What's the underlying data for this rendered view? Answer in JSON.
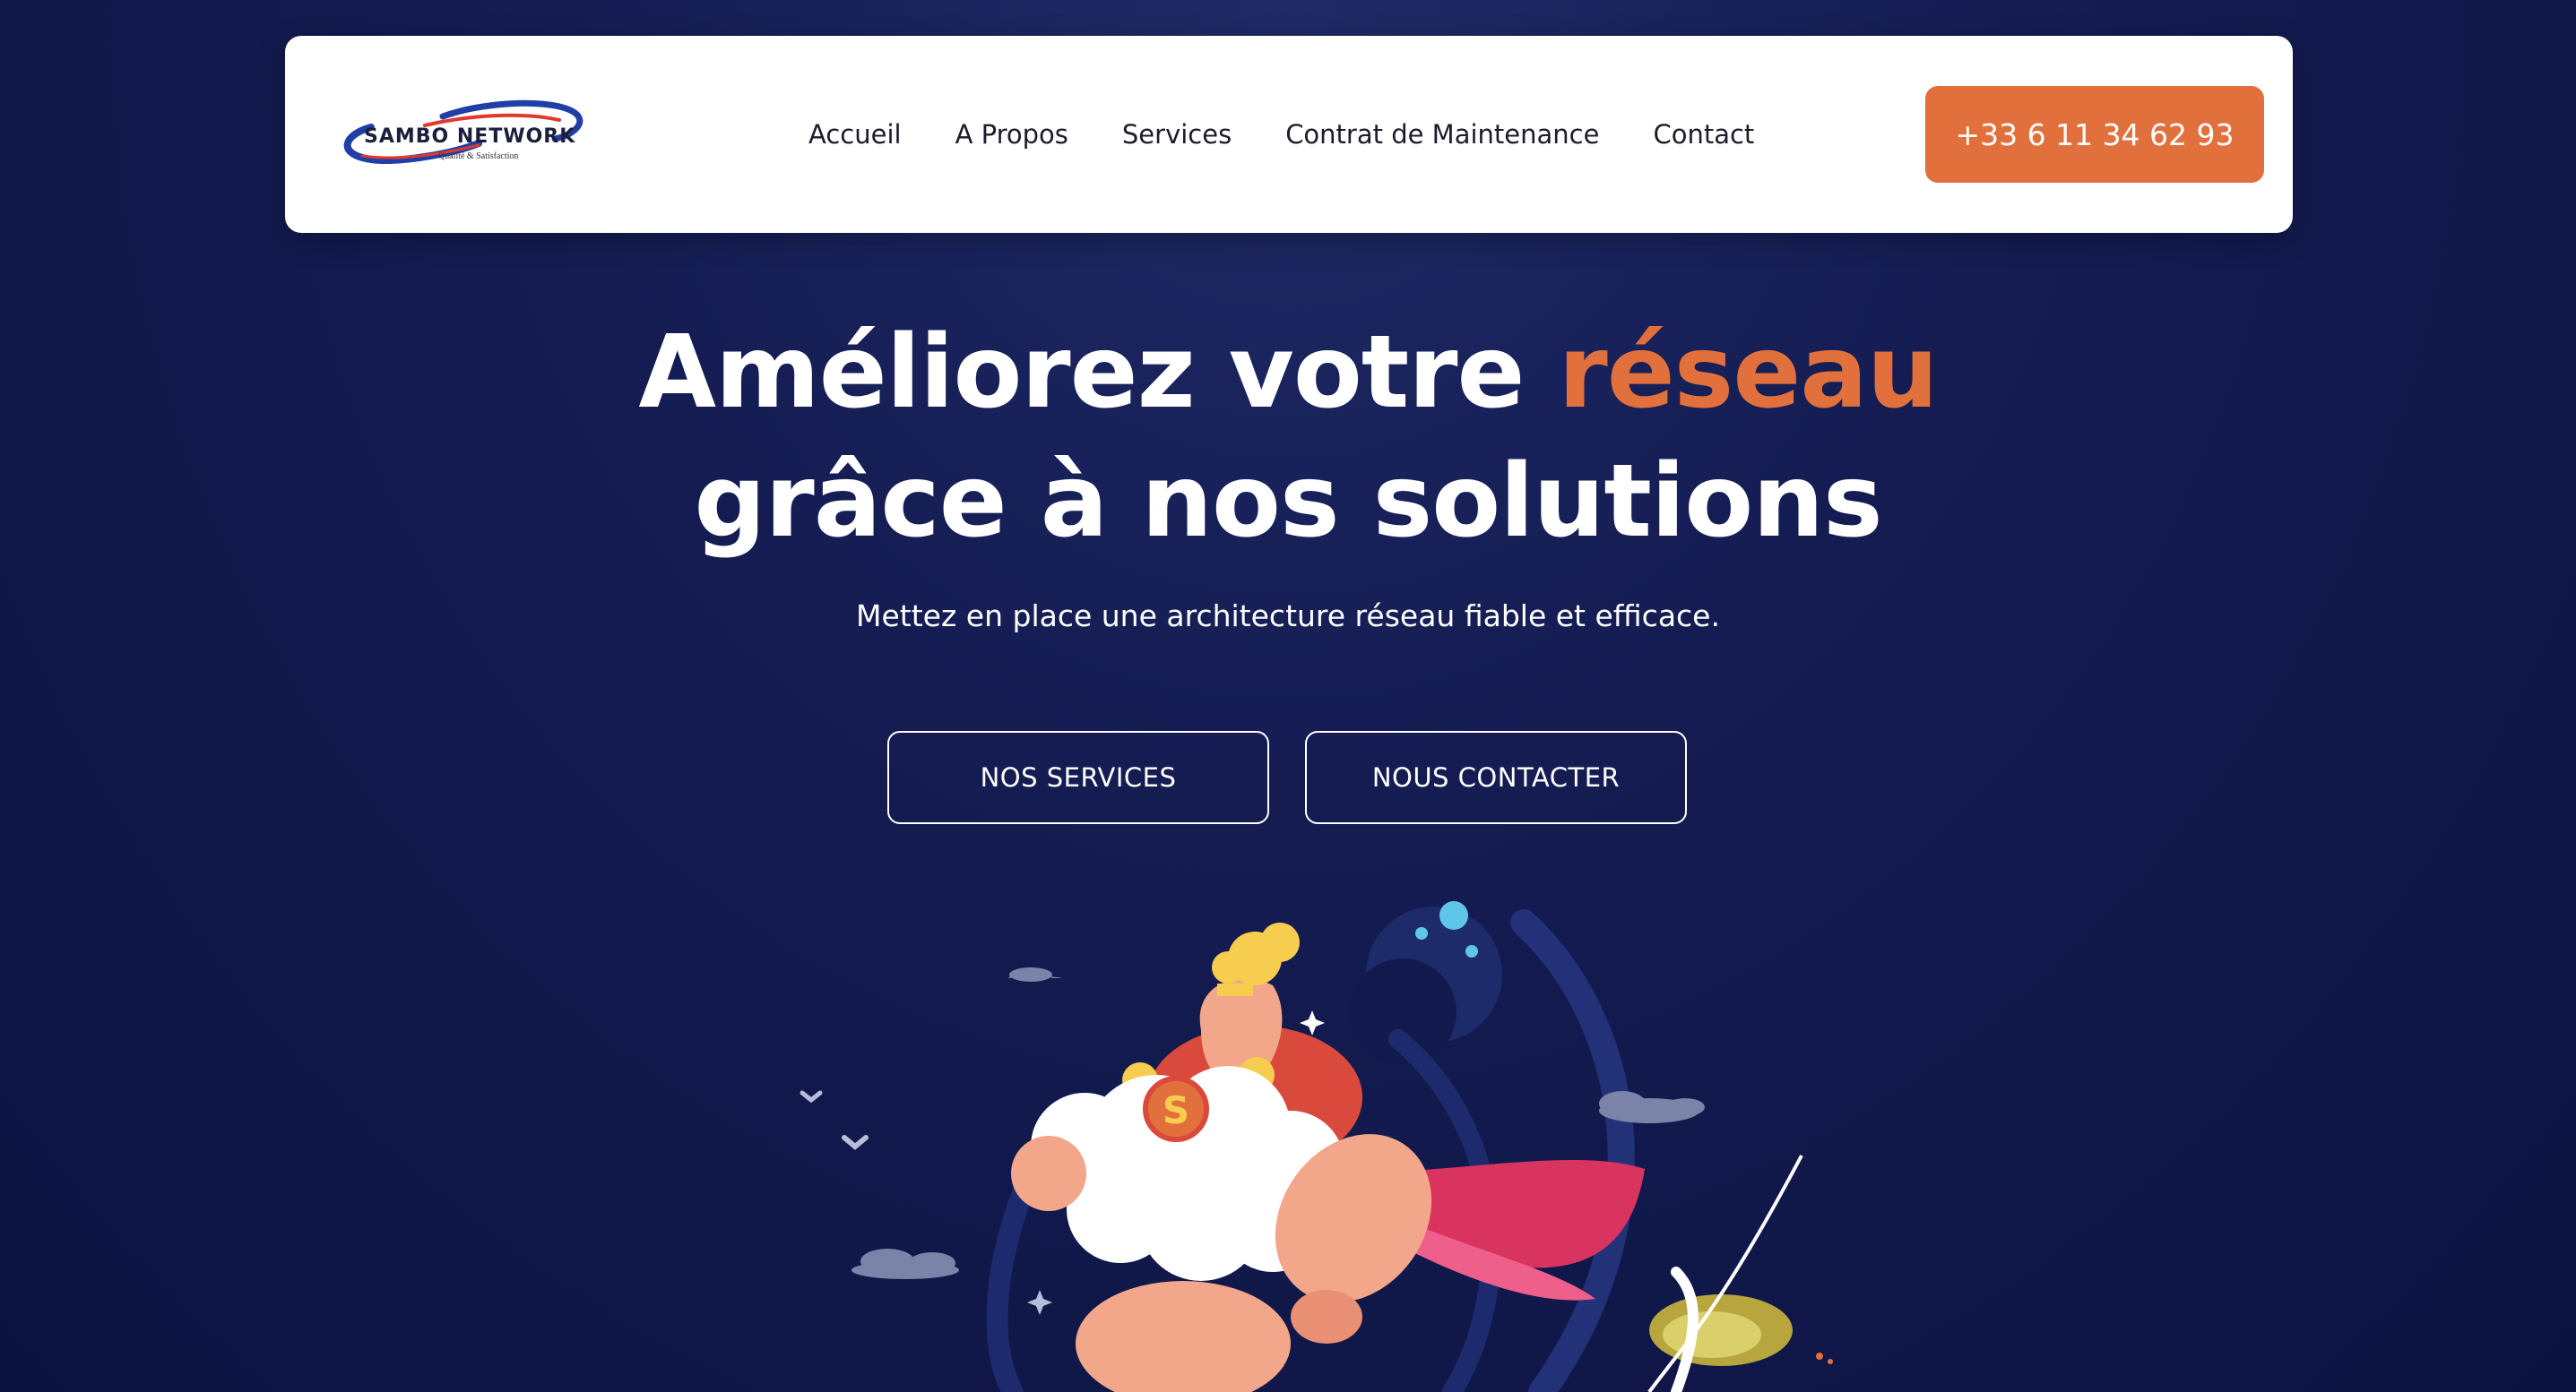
{
  "header": {
    "logo": {
      "name": "SAMBO NETWORK",
      "tagline": "Qualité & Satisfaction"
    },
    "nav": [
      {
        "label": "Accueil"
      },
      {
        "label": "A Propos"
      },
      {
        "label": "Services"
      },
      {
        "label": "Contrat de Maintenance"
      },
      {
        "label": "Contact"
      }
    ],
    "phone_label": "+33 6 11 34 62 93"
  },
  "hero": {
    "title_line1_prefix": "Améliorez votre ",
    "title_line1_accent": "réseau",
    "title_line2": "grâce à nos solutions",
    "subtitle": "Mettez en place une architecture réseau fiable et efficace.",
    "buttons": [
      {
        "label": "NOS SERVICES"
      },
      {
        "label": "NOUS CONTACTER"
      }
    ],
    "illustration_icon": "superhero-illustration",
    "badge_letter": "S"
  },
  "colors": {
    "accent": "#e2703d",
    "background": "#141c52",
    "header_bg": "#ffffff",
    "logo_blue": "#1f3fa6",
    "logo_red": "#e2382b"
  }
}
